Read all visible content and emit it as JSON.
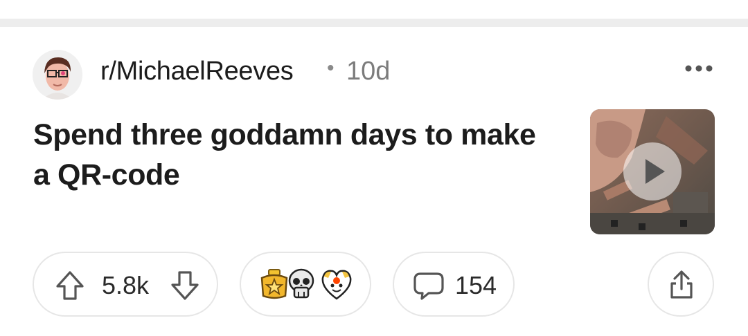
{
  "post": {
    "community": "r/MichaelReeves",
    "separator": "•",
    "age": "10d",
    "title": "Spend three goddamn days to make a QR-code",
    "media": "video-thumbnail"
  },
  "actions": {
    "upvotes": "5.8k",
    "comments": "154",
    "awards": [
      "star-badge-award-icon",
      "skull-award-icon",
      "heart-face-award-icon"
    ]
  },
  "colors": {
    "text": "#1c1c1c",
    "muted": "#7c7c7c",
    "border": "#e6e6e6",
    "divider": "#ededed"
  }
}
